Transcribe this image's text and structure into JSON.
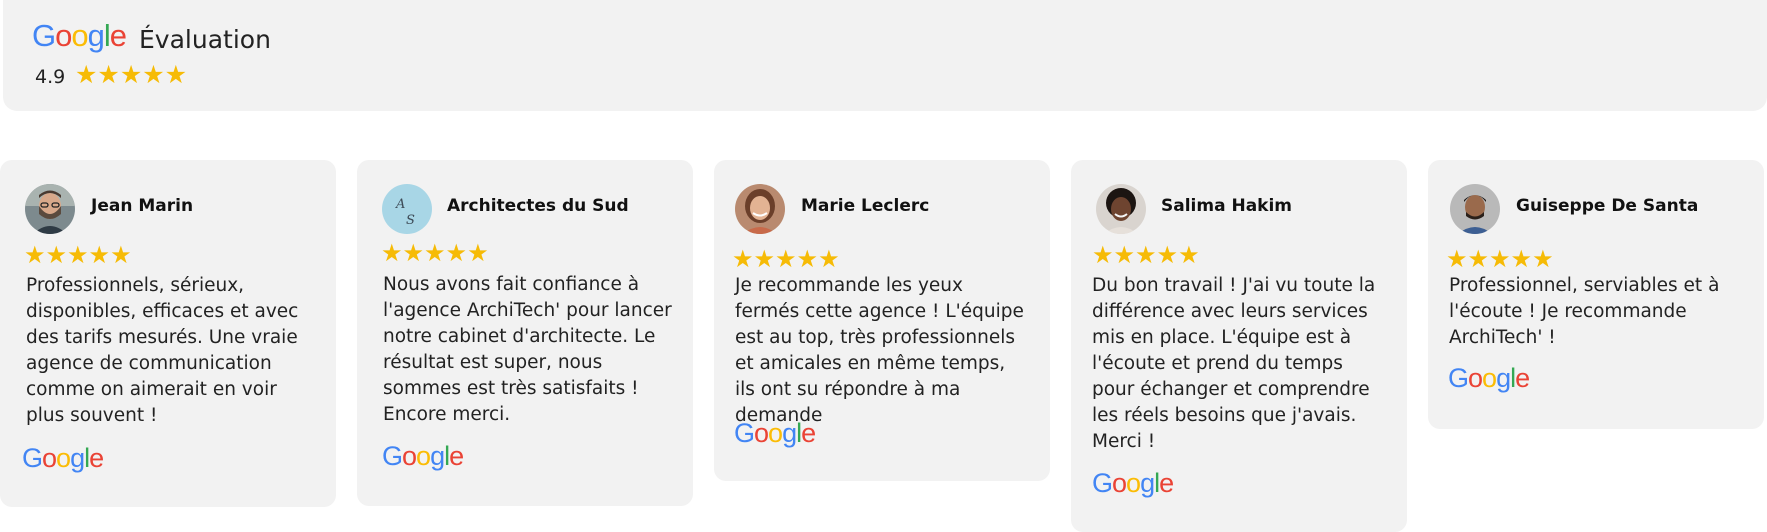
{
  "header": {
    "logo_text": "Google",
    "title": "Évaluation",
    "rating": "4.9",
    "stars": "★★★★★"
  },
  "reviews": [
    {
      "name": "Jean Marin",
      "stars": "★★★★★",
      "rating": 5,
      "text": "Professionnels, sérieux, disponibles, efficaces et avec des tarifs mesurés. Une vraie agence de communication comme on aimerait en voir plus souvent !",
      "logo": "Google",
      "avatar": "person-photo"
    },
    {
      "name": "Architectes du Sud",
      "stars": "★★★★★",
      "rating": 5,
      "text": "Nous avons fait confiance à l'agence ArchiTech' pour lancer notre cabinet d'architecte. Le résultat est super, nous sommes est très satisfaits ! Encore merci.",
      "logo": "Google",
      "avatar_letters": "A S"
    },
    {
      "name": "Marie Leclerc",
      "stars": "★★★★★",
      "rating": 5,
      "text": "Je recommande les yeux fermés cette agence ! L'équipe est au top, très professionnels et amicales en même temps, ils ont su répondre à ma demande",
      "logo": "Google",
      "avatar": "person-photo"
    },
    {
      "name": "Salima Hakim",
      "stars": "★★★★★",
      "rating": 5,
      "text": "Du bon travail ! J'ai vu toute la différence avec leurs services mis en place. L'équipe est à l'écoute et prend du temps pour échanger et comprendre les réels besoins que j'avais. Merci !",
      "logo": "Google",
      "avatar": "person-photo"
    },
    {
      "name": "Guiseppe De Santa",
      "stars": "★★★★★",
      "rating": 5,
      "text": "Professionnel, serviables et à l'écoute ! Je recommande ArchiTech' !",
      "logo": "Google",
      "avatar": "person-photo"
    }
  ],
  "colors": {
    "card_bg": "#f2f2f2",
    "star": "#f6bb06",
    "google_blue": "#4285f4",
    "google_red": "#ea4335",
    "google_yellow": "#fbbc05",
    "google_green": "#34a853"
  }
}
